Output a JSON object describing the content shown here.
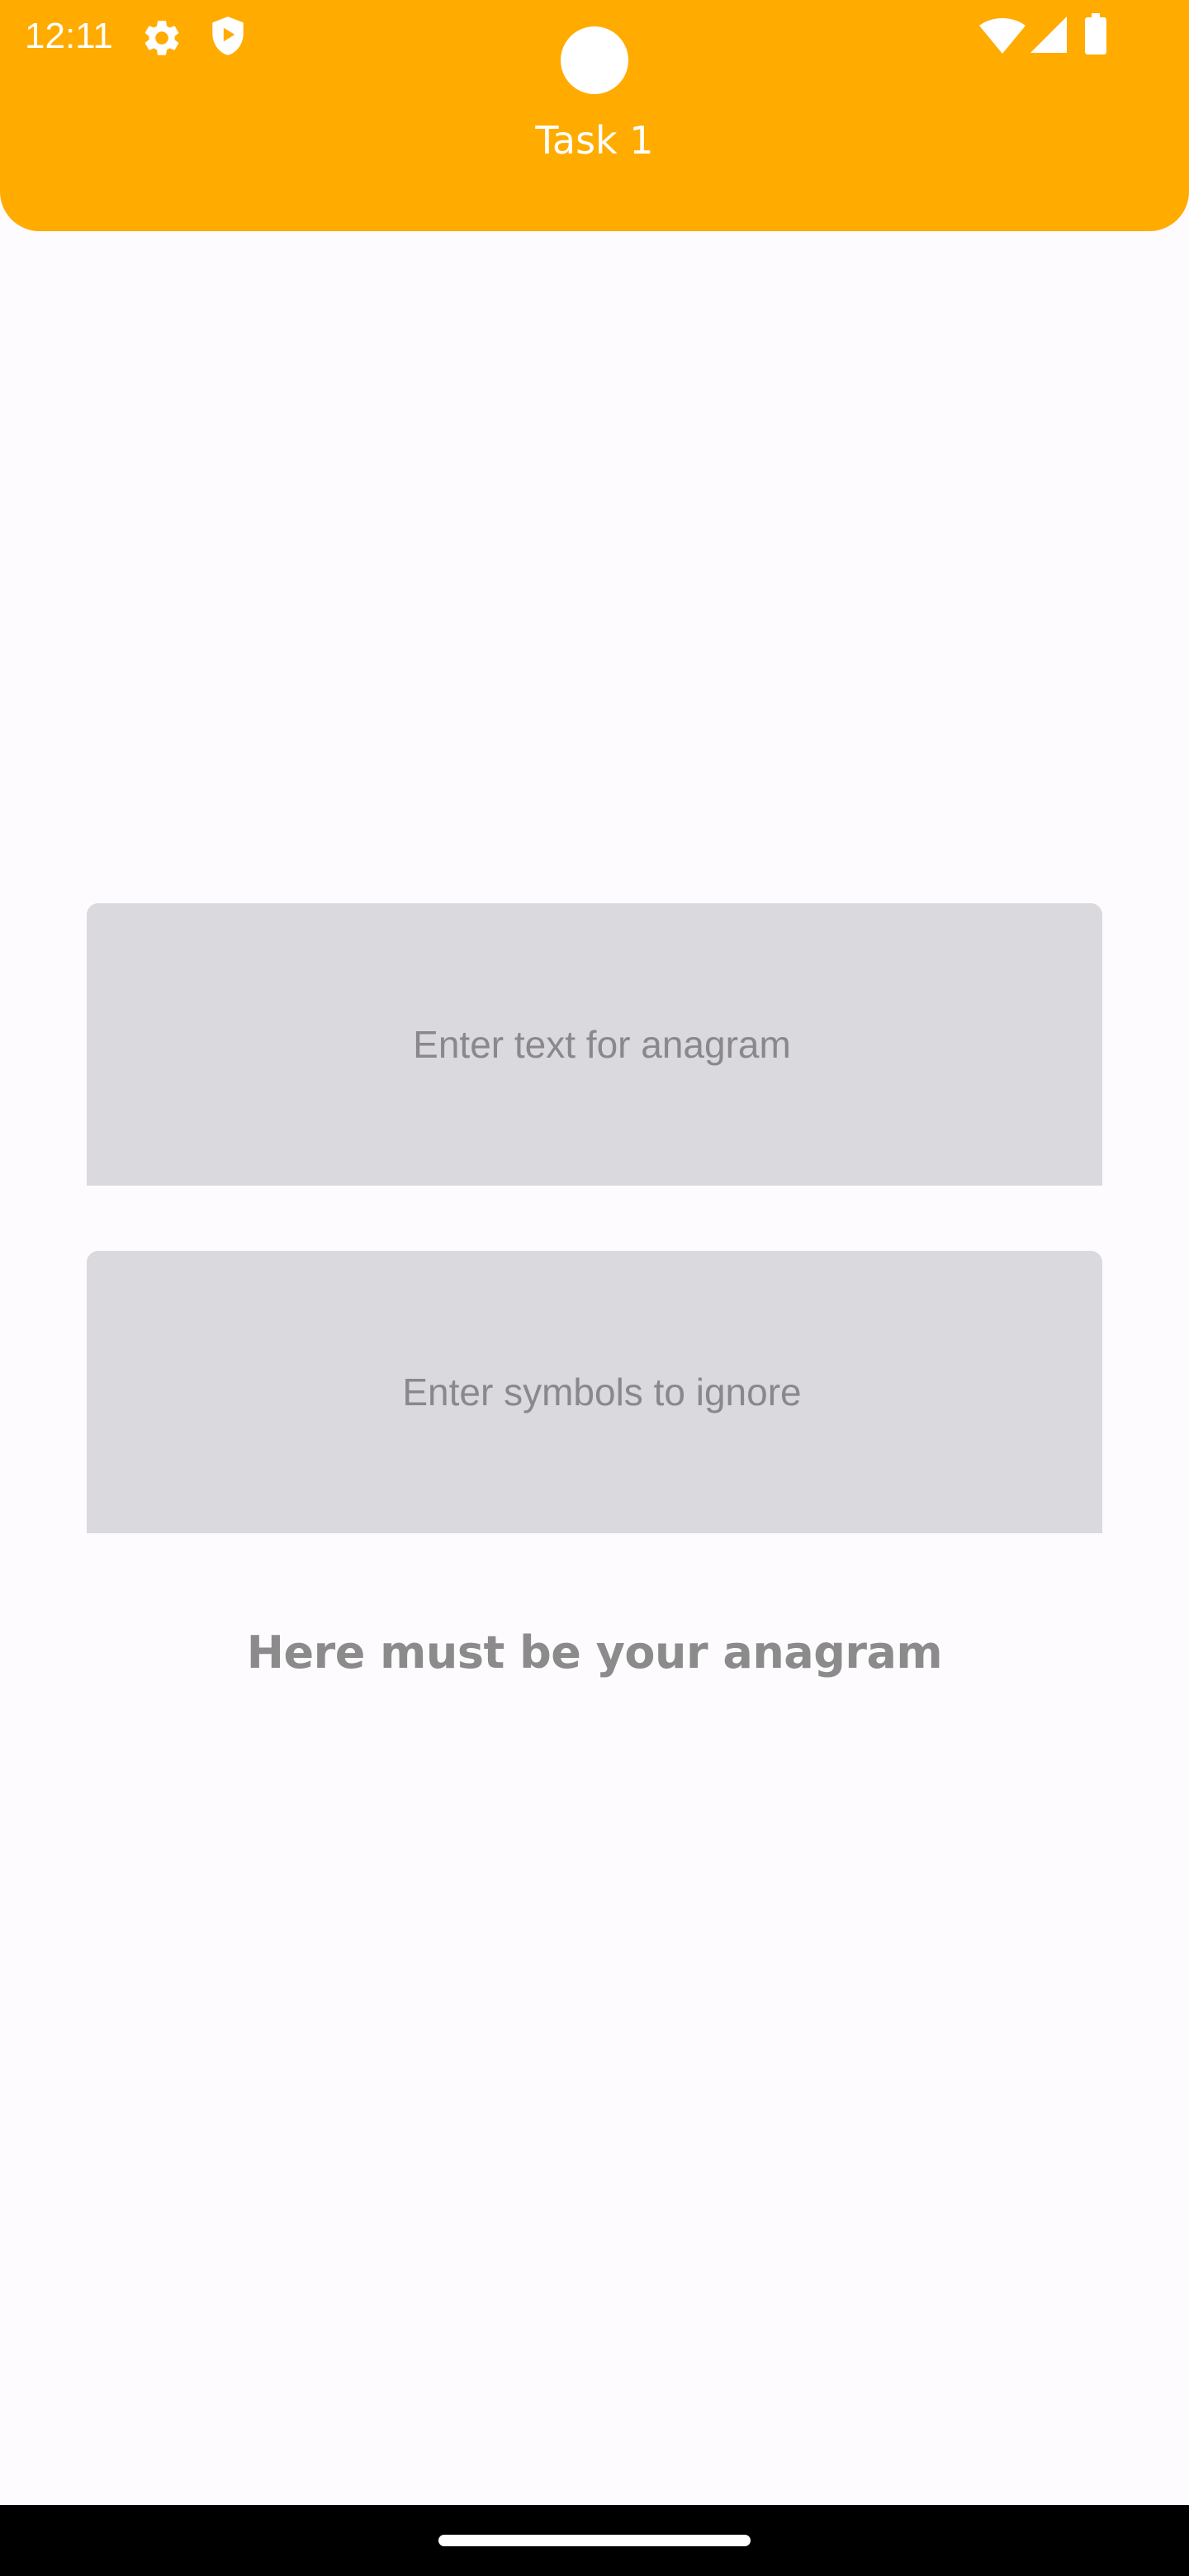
{
  "status_bar": {
    "time": "12:11",
    "icons": [
      "gear-icon",
      "shield-play-icon",
      "wifi-icon",
      "signal-icon",
      "battery-icon"
    ]
  },
  "app_bar": {
    "title": "Task 1",
    "color": "#ffab00"
  },
  "form": {
    "anagram_input": {
      "placeholder": "Enter text for anagram",
      "value": ""
    },
    "ignore_input": {
      "placeholder": "Enter symbols to ignore",
      "value": ""
    }
  },
  "result": {
    "text": "Here must be your anagram"
  },
  "colors": {
    "background": "#fefbfe",
    "field_background": "#dad9dd",
    "placeholder": "#8a888d",
    "result_text": "#8b8b8b"
  }
}
